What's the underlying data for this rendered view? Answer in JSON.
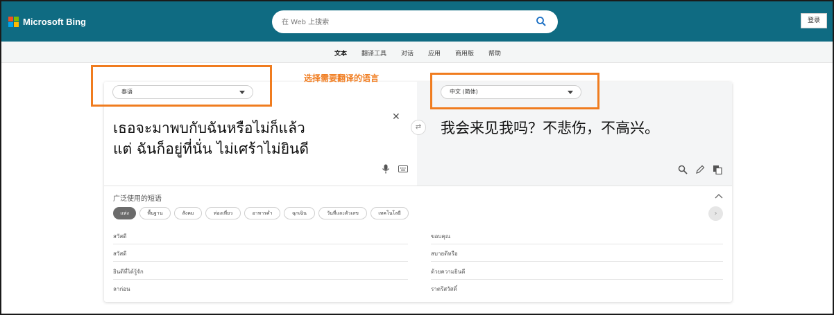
{
  "header": {
    "brand": "Microsoft Bing",
    "search_placeholder": "在 Web 上搜索",
    "login_label": "登录",
    "logo_colors": [
      "#f25022",
      "#7fba00",
      "#00a4ef",
      "#ffb900"
    ],
    "header_color": "#0f6b82"
  },
  "nav": {
    "items": [
      {
        "label": "文本",
        "active": true
      },
      {
        "label": "翻译工具",
        "active": false
      },
      {
        "label": "对话",
        "active": false
      },
      {
        "label": "应用",
        "active": false
      },
      {
        "label": "商用版",
        "active": false
      },
      {
        "label": "帮助",
        "active": false
      }
    ]
  },
  "annotation": {
    "label": "选择需要翻译的语言",
    "color": "#f07c1f"
  },
  "translator": {
    "source_language": "泰语",
    "target_language": "中文 (简体)",
    "source_lines": [
      "เธอจะมาพบกับฉันหรือไม่ก็แล้ว",
      "แต่ ฉันก็อยู่ที่นั่น ไม่เศร้าไม่ยินดี"
    ],
    "translation": "我会来见我吗？不悲伤，不高兴。",
    "swap_icon": "swap-arrows-icon"
  },
  "phrases": {
    "title": "广泛使用的短语",
    "categories": [
      "แห่ง",
      "พื้นฐาน",
      "สังคม",
      "ท่องเที่ยว",
      "อาหารค่ำ",
      "ฉุกเฉิน",
      "วันที่และตัวเลข",
      "เทคโนโลยี"
    ],
    "active_category": "แห่ง",
    "left": [
      "สวัสดี",
      "สวัสดี",
      "ยินดีที่ได้รู้จัก",
      "ลาก่อน"
    ],
    "right": [
      "ขอบคุณ",
      "สบายดีหรือ",
      "ด้วยความยินดี",
      "ราตรีสวัสดิ์"
    ]
  }
}
